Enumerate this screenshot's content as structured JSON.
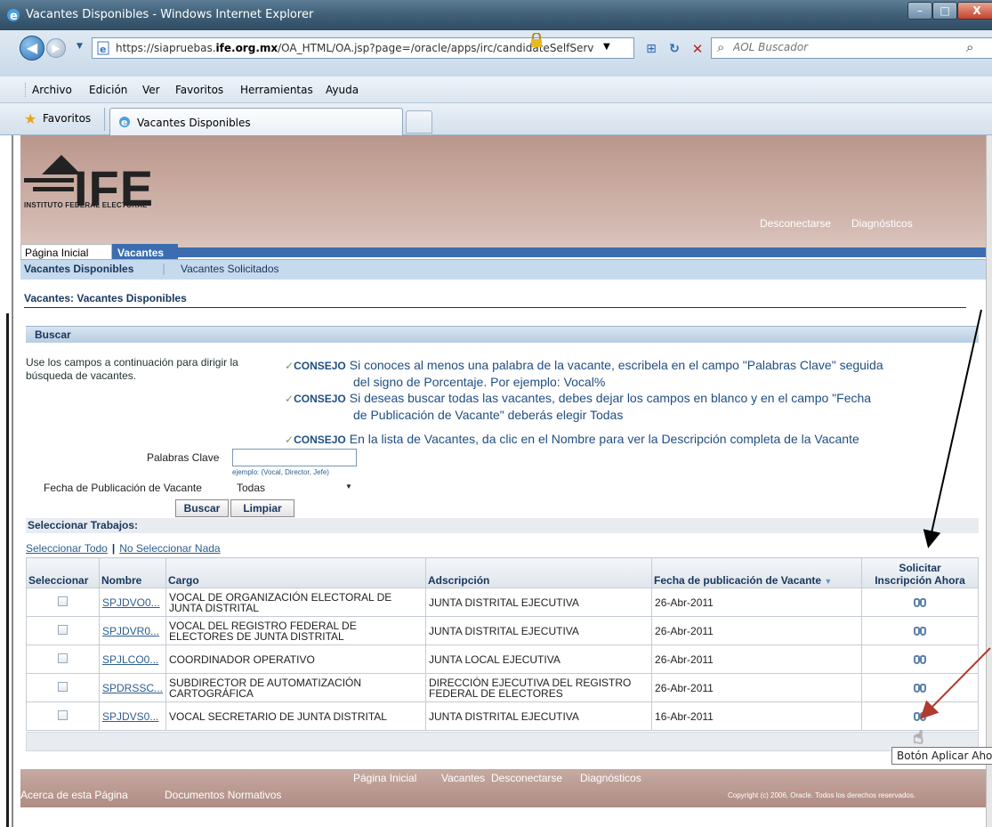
{
  "window": {
    "title": "Vacantes Disponibles - Windows Internet Explorer",
    "minimize": "–",
    "maximize": "□",
    "close": "X"
  },
  "address": {
    "url_prefix": "https://siapruebas.",
    "url_domain": "ife.org.mx",
    "url_rest": "/OA_HTML/OA.jsp?page=/oracle/apps/irc/candidateSelfServ"
  },
  "search": {
    "placeholder": "AOL Buscador"
  },
  "menu": [
    "Archivo",
    "Edición",
    "Ver",
    "Favoritos",
    "Herramientas",
    "Ayuda"
  ],
  "favorites": {
    "label": "Favoritos",
    "tab": "Vacantes Disponibles"
  },
  "header": {
    "logo_text": "IFE",
    "logo_sub": "INSTITUTO FEDERAL ELECTORAL",
    "global_links": [
      "Desconectarse",
      "Diagnósticos"
    ]
  },
  "tabs": {
    "home": "Página Inicial",
    "vacantes": "Vacantes"
  },
  "subnav": {
    "current": "Vacantes Disponibles",
    "separator": "|",
    "other": "Vacantes Solicitados"
  },
  "page_title": "Vacantes: Vacantes Disponibles",
  "search_section": {
    "heading": "Buscar",
    "instructions": "Use los campos a continuación para dirigir la búsqueda de vacantes.",
    "tips": [
      {
        "label": "CONSEJO",
        "line1": "Si conoces al menos una palabra de la vacante, escribela en el campo \"Palabras Clave\" seguida",
        "line2": "del signo de Porcentaje. Por ejemplo: Vocal%"
      },
      {
        "label": "CONSEJO",
        "line1": "Si deseas buscar todas las vacantes, debes dejar los campos en blanco y en el campo \"Fecha",
        "line2": "de Publicación de Vacante\" deberás elegir Todas"
      },
      {
        "label": "CONSEJO",
        "line1": "En la lista de Vacantes, da clic en el Nombre para ver la Descripción completa de la Vacante",
        "line2": ""
      }
    ],
    "keywords_label": "Palabras Clave",
    "keywords_value": "",
    "keywords_hint": "ejemplo: (Vocal, Director, Jefe)",
    "date_label": "Fecha de Publicación de Vacante",
    "date_value": "Todas",
    "buscar": "Buscar",
    "limpiar": "Limpiar"
  },
  "selection": {
    "heading": "Seleccionar Trabajos:",
    "select_all": "Seleccionar Todo",
    "pipe": "|",
    "select_none": "No Seleccionar Nada"
  },
  "table": {
    "headers": {
      "select": "Seleccionar",
      "name": "Nombre",
      "position": "Cargo",
      "assignment": "Adscripción",
      "date": "Fecha de publicación de Vacante",
      "apply_1": "Solicitar",
      "apply_2": "Inscripción Ahora"
    },
    "rows": [
      {
        "name": "SPJDVO0...",
        "position": "VOCAL DE ORGANIZACIÓN ELECTORAL DE JUNTA DISTRITAL",
        "assignment": "JUNTA DISTRITAL EJECUTIVA",
        "date": "26-Abr-2011"
      },
      {
        "name": "SPJDVR0...",
        "position": "VOCAL DEL REGISTRO FEDERAL DE ELECTORES DE JUNTA DISTRITAL",
        "assignment": "JUNTA DISTRITAL EJECUTIVA",
        "date": "26-Abr-2011"
      },
      {
        "name": "SPJLCO0...",
        "position": "COORDINADOR OPERATIVO",
        "assignment": "JUNTA LOCAL EJECUTIVA",
        "date": "26-Abr-2011"
      },
      {
        "name": "SPDRSSC...",
        "position": "SUBDIRECTOR DE AUTOMATIZACIÓN CARTOGRÁFICA",
        "assignment": "DIRECCIÓN EJECUTIVA DEL REGISTRO FEDERAL DE ELECTORES",
        "date": "26-Abr-2011"
      },
      {
        "name": "SPJDVS0...",
        "position": "VOCAL SECRETARIO DE JUNTA DISTRITAL",
        "assignment": "JUNTA DISTRITAL EJECUTIVA",
        "date": "16-Abr-2011"
      }
    ]
  },
  "footer": {
    "links": [
      "Página Inicial",
      "Vacantes",
      "Desconectarse",
      "Diagnósticos"
    ],
    "about": "Acerca de esta Página",
    "docs": "Documentos Normativos",
    "copyright": "Copyright (c) 2006, Oracle. Todos los derechos reservados."
  },
  "tooltip": "Botón Aplicar Aho",
  "colors": {
    "accent": "#3c6db0",
    "header": "#c8a89e",
    "link": "#2c5e8e",
    "arrow_black": "#000000",
    "arrow_red": "#b03a2e"
  },
  "icons": [
    "ie-icon",
    "back-arrow-icon",
    "forward-arrow-icon",
    "lock-icon",
    "refresh-icon",
    "stop-icon",
    "search-icon",
    "star-icon",
    "check-icon",
    "apply-now-icon",
    "hand-cursor-icon",
    "dropdown-arrow-icon"
  ]
}
